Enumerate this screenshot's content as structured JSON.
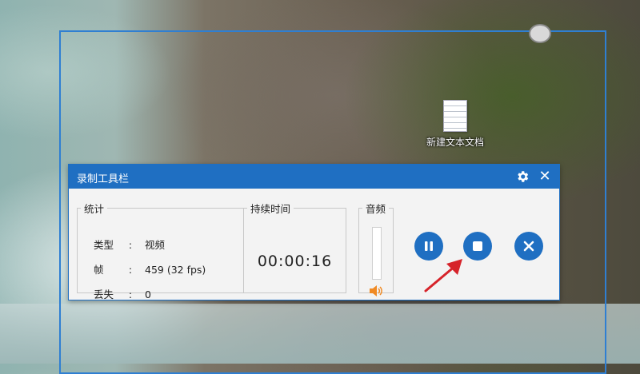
{
  "desktop": {
    "icon_label": "新建文本文档"
  },
  "toolbar": {
    "title": "录制工具栏",
    "stats": {
      "legend": "统计",
      "rows": [
        {
          "key": "类型",
          "colon": ":",
          "value": "视频"
        },
        {
          "key": "帧",
          "colon": ":",
          "value": "459 (32 fps)"
        },
        {
          "key": "丢失",
          "colon": ":",
          "value": "0"
        }
      ]
    },
    "duration": {
      "legend": "持续时间",
      "time": "00:00:16"
    },
    "audio": {
      "legend": "音频",
      "level": 0
    },
    "icons": {
      "settings": "gear-icon",
      "close": "close-icon",
      "pause": "pause-icon",
      "stop": "stop-icon",
      "cancel": "cancel-icon",
      "speaker": "speaker-icon"
    }
  },
  "colors": {
    "accent": "#1f6fc2",
    "frame": "#2f7fd2",
    "annotation_arrow": "#d6232a",
    "speaker": "#f08a24"
  }
}
